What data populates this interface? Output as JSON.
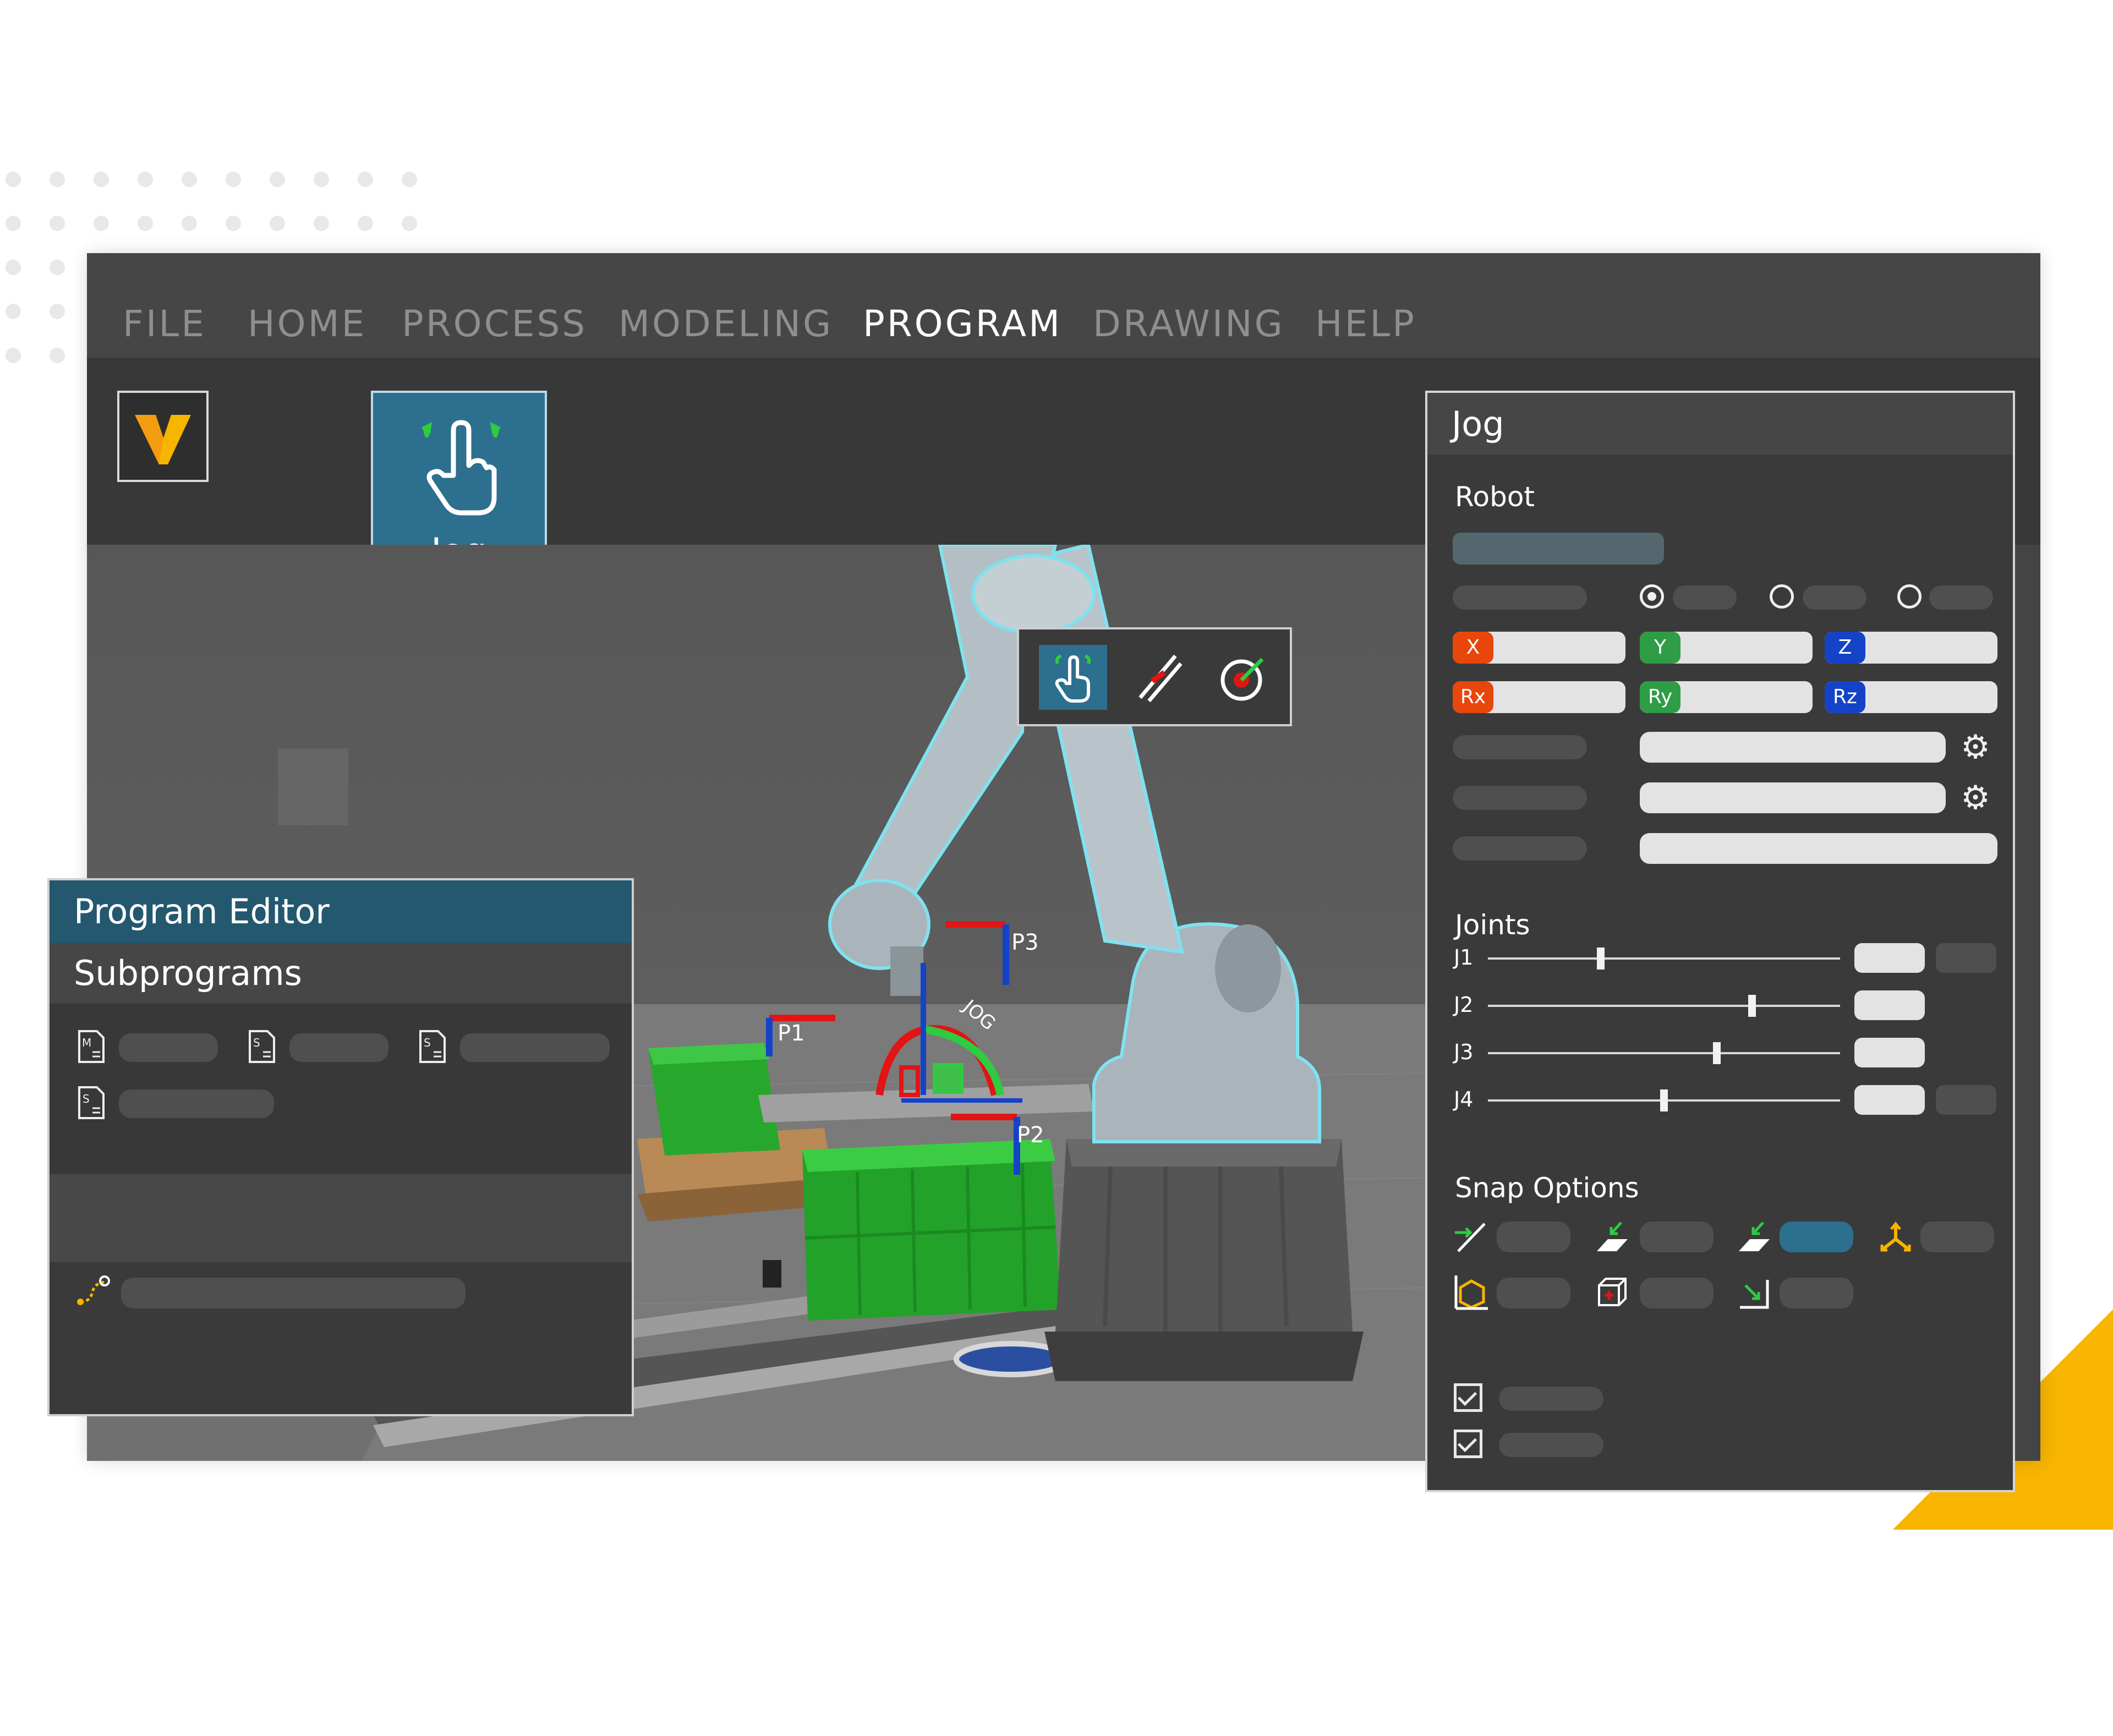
{
  "menu": {
    "items": [
      "FILE",
      "HOME",
      "PROCESS",
      "MODELING",
      "PROGRAM",
      "DRAWING",
      "HELP"
    ],
    "active": "PROGRAM"
  },
  "ribbon": {
    "jog_button_label": "Jog"
  },
  "viewport": {
    "points": [
      "P1",
      "P2",
      "P3"
    ],
    "jog_gizmo_label": "JOG"
  },
  "program_editor": {
    "title": "Program Editor",
    "subtitle": "Subprograms"
  },
  "jog_panel": {
    "title": "Jog",
    "robot_section": "Robot",
    "axes": [
      "X",
      "Y",
      "Z"
    ],
    "rotations": [
      "Rx",
      "Ry",
      "Rz"
    ],
    "joints_section": "Joints",
    "joints": [
      {
        "label": "J1",
        "level": 0.32
      },
      {
        "label": "J2",
        "level": 0.75
      },
      {
        "label": "J3",
        "level": 0.65
      },
      {
        "label": "J4",
        "level": 0.5
      }
    ],
    "snap_section": "Snap Options"
  },
  "colors": {
    "accent": "#2d6f8f",
    "x_axis": "#e8460c",
    "y_axis": "#2f9d45",
    "z_axis": "#1443c8",
    "brand": "#f7b500"
  }
}
